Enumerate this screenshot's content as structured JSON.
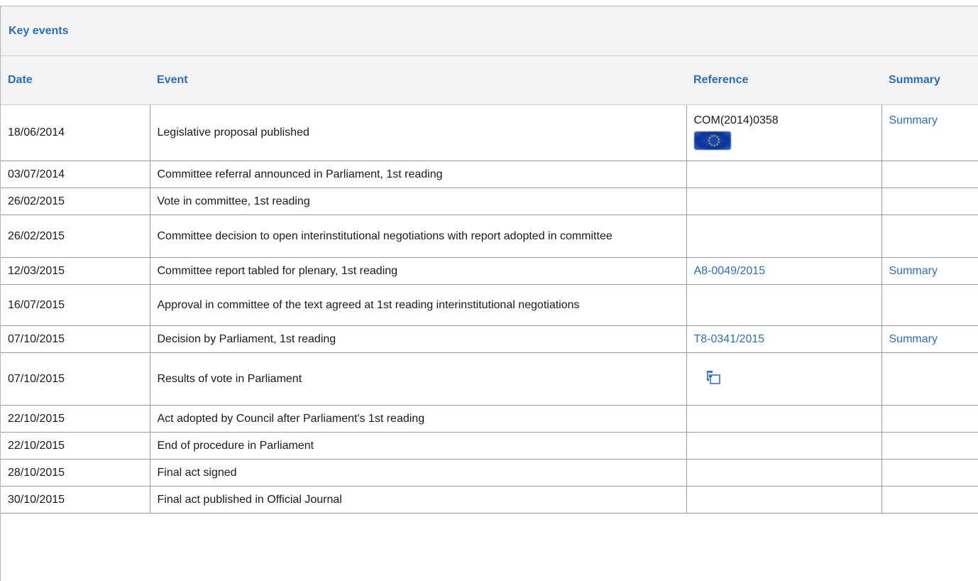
{
  "panel": {
    "title": "Key events"
  },
  "table": {
    "headers": {
      "date": "Date",
      "event": "Event",
      "reference": "Reference",
      "summary": "Summary"
    },
    "rows": [
      {
        "date": "18/06/2014",
        "event": "Legislative proposal published",
        "reference": "COM(2014)0358",
        "reference_icon": "eu-flag-icon",
        "summary": "Summary"
      },
      {
        "date": "03/07/2014",
        "event": "Committee referral announced in Parliament, 1st reading",
        "reference": "",
        "summary": ""
      },
      {
        "date": "26/02/2015",
        "event": "Vote in committee, 1st reading",
        "reference": "",
        "summary": ""
      },
      {
        "date": "26/02/2015",
        "event": "Committee decision to open interinstitutional negotiations with report adopted in committee",
        "reference": "",
        "summary": ""
      },
      {
        "date": "12/03/2015",
        "event": "Committee report tabled for plenary, 1st reading",
        "reference": "A8-0049/2015",
        "summary": "Summary"
      },
      {
        "date": "16/07/2015",
        "event": "Approval in committee of the text agreed at 1st reading interinstitutional negotiations",
        "reference": "",
        "summary": ""
      },
      {
        "date": "07/10/2015",
        "event": "Decision by Parliament, 1st reading",
        "reference": "T8-0341/2015",
        "summary": "Summary"
      },
      {
        "date": "07/10/2015",
        "event": "Results of vote in Parliament",
        "reference": "",
        "reference_icon": "vote-results-icon",
        "summary": ""
      },
      {
        "date": "22/10/2015",
        "event": "Act adopted by Council after Parliament's 1st reading",
        "reference": "",
        "summary": ""
      },
      {
        "date": "22/10/2015",
        "event": "End of procedure in Parliament",
        "reference": "",
        "summary": ""
      },
      {
        "date": "28/10/2015",
        "event": "Final act signed",
        "reference": "",
        "summary": ""
      },
      {
        "date": "30/10/2015",
        "event": "Final act published in Official Journal",
        "reference": "",
        "summary": ""
      }
    ]
  },
  "colors": {
    "link": "#2d6eb3",
    "header_bg": "#f3f3f3",
    "border": "#9a9a9a"
  }
}
